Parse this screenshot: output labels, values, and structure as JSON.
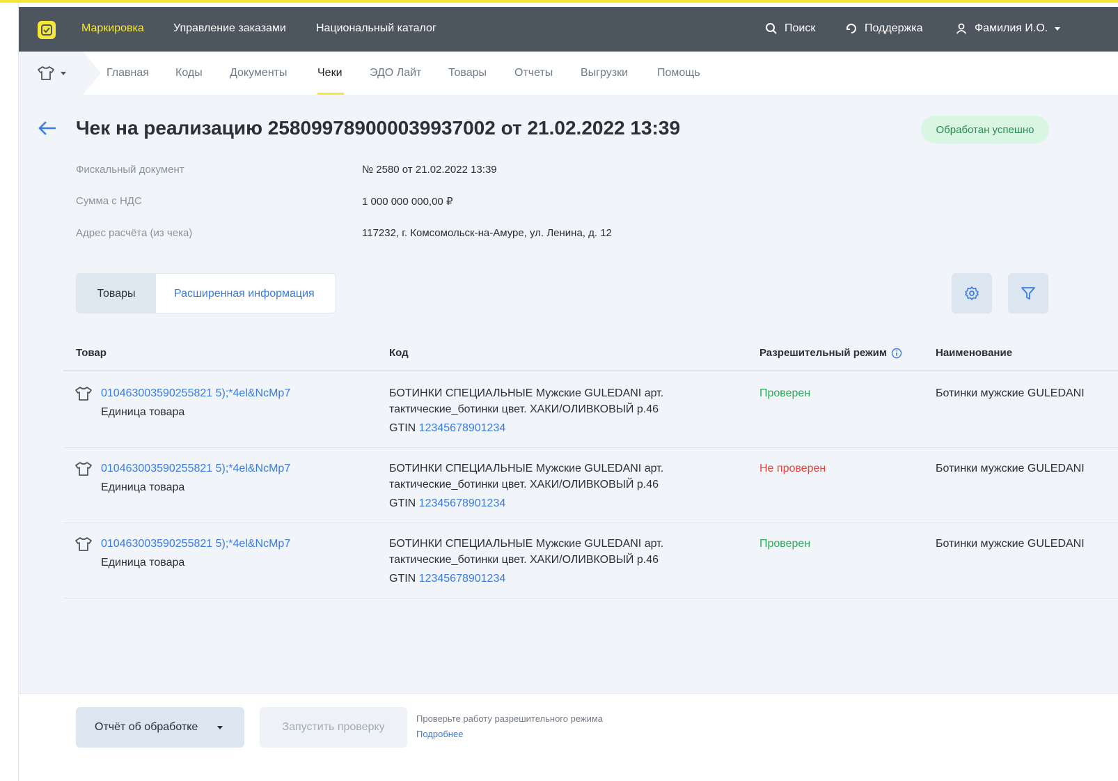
{
  "topbar": {
    "brand": "Маркировка",
    "nav": [
      "Управление заказами",
      "Национальный каталог"
    ],
    "search": "Поиск",
    "support": "Поддержка",
    "user": "Фамилия И.О."
  },
  "subnav": {
    "items": [
      "Главная",
      "Коды",
      "Документы",
      "Чеки",
      "ЭДО Лайт",
      "Товары",
      "Отчеты",
      "Выгрузки",
      "Помощь"
    ],
    "active": "Чеки"
  },
  "header": {
    "title": "Чек на реализацию 258099789000039937002 от 21.02.2022 13:39",
    "status": "Обработан успешно"
  },
  "info": [
    {
      "label": "Фискальный документ",
      "value": "№ 2580 от 21.02.2022 13:39"
    },
    {
      "label": "Сумма с НДС",
      "value": "1 000 000 000,00 ₽"
    },
    {
      "label": "Адрес расчёта (из чека)",
      "value": "117232, г. Комсомольск-на-Амуре, ул. Ленина, д. 12"
    }
  ],
  "tabs": [
    "Товары",
    "Расширенная информация"
  ],
  "table": {
    "headers": [
      "Товар",
      "Код",
      "Разрешительный режим",
      "Наименование"
    ],
    "rows": [
      {
        "code": "010463003590255821 5);*4el&NcMp7",
        "unit": "Единица товара",
        "desc1": "БОТИНКИ СПЕЦИАЛЬНЫЕ Мужские GULEDANI арт.",
        "desc2": "тактические_ботинки цвет. ХАКИ/ОЛИВКОВЫЙ р.46",
        "gtin_label": "GTIN",
        "gtin": "12345678901234",
        "status": "Проверен",
        "name": "Ботинки мужские GULEDANI"
      },
      {
        "code": "010463003590255821 5);*4el&NcMp7",
        "unit": "Единица товара",
        "desc1": "БОТИНКИ СПЕЦИАЛЬНЫЕ Мужские GULEDANI арт.",
        "desc2": "тактические_ботинки цвет. ХАКИ/ОЛИВКОВЫЙ р.46",
        "gtin_label": "GTIN",
        "gtin": "12345678901234",
        "status": "Не проверен",
        "name": "Ботинки мужские GULEDANI"
      },
      {
        "code": "010463003590255821 5);*4el&NcMp7",
        "unit": "Единица товара",
        "desc1": "БОТИНКИ СПЕЦИАЛЬНЫЕ Мужские GULEDANI арт.",
        "desc2": "тактические_ботинки цвет. ХАКИ/ОЛИВКОВЫЙ р.46",
        "gtin_label": "GTIN",
        "gtin": "12345678901234",
        "status": "Проверен",
        "name": "Ботинки мужские GULEDANI"
      }
    ]
  },
  "footer": {
    "report": "Отчёт об обработке",
    "run": "Запустить проверку",
    "hint": "Проверьте работу разрешительного режима",
    "more": "Подробнее"
  },
  "colors": {
    "accent": "#f5e83a",
    "topbar": "#4d555e",
    "link": "#3a7be0",
    "ok": "#2fa85a",
    "fail": "#e2453c",
    "badge_bg": "#d9f6e3"
  },
  "icons": [
    "logo-icon",
    "search-icon",
    "support-icon",
    "user-icon",
    "tshirt-icon",
    "back-arrow-icon",
    "gear-icon",
    "filter-icon",
    "info-icon"
  ]
}
